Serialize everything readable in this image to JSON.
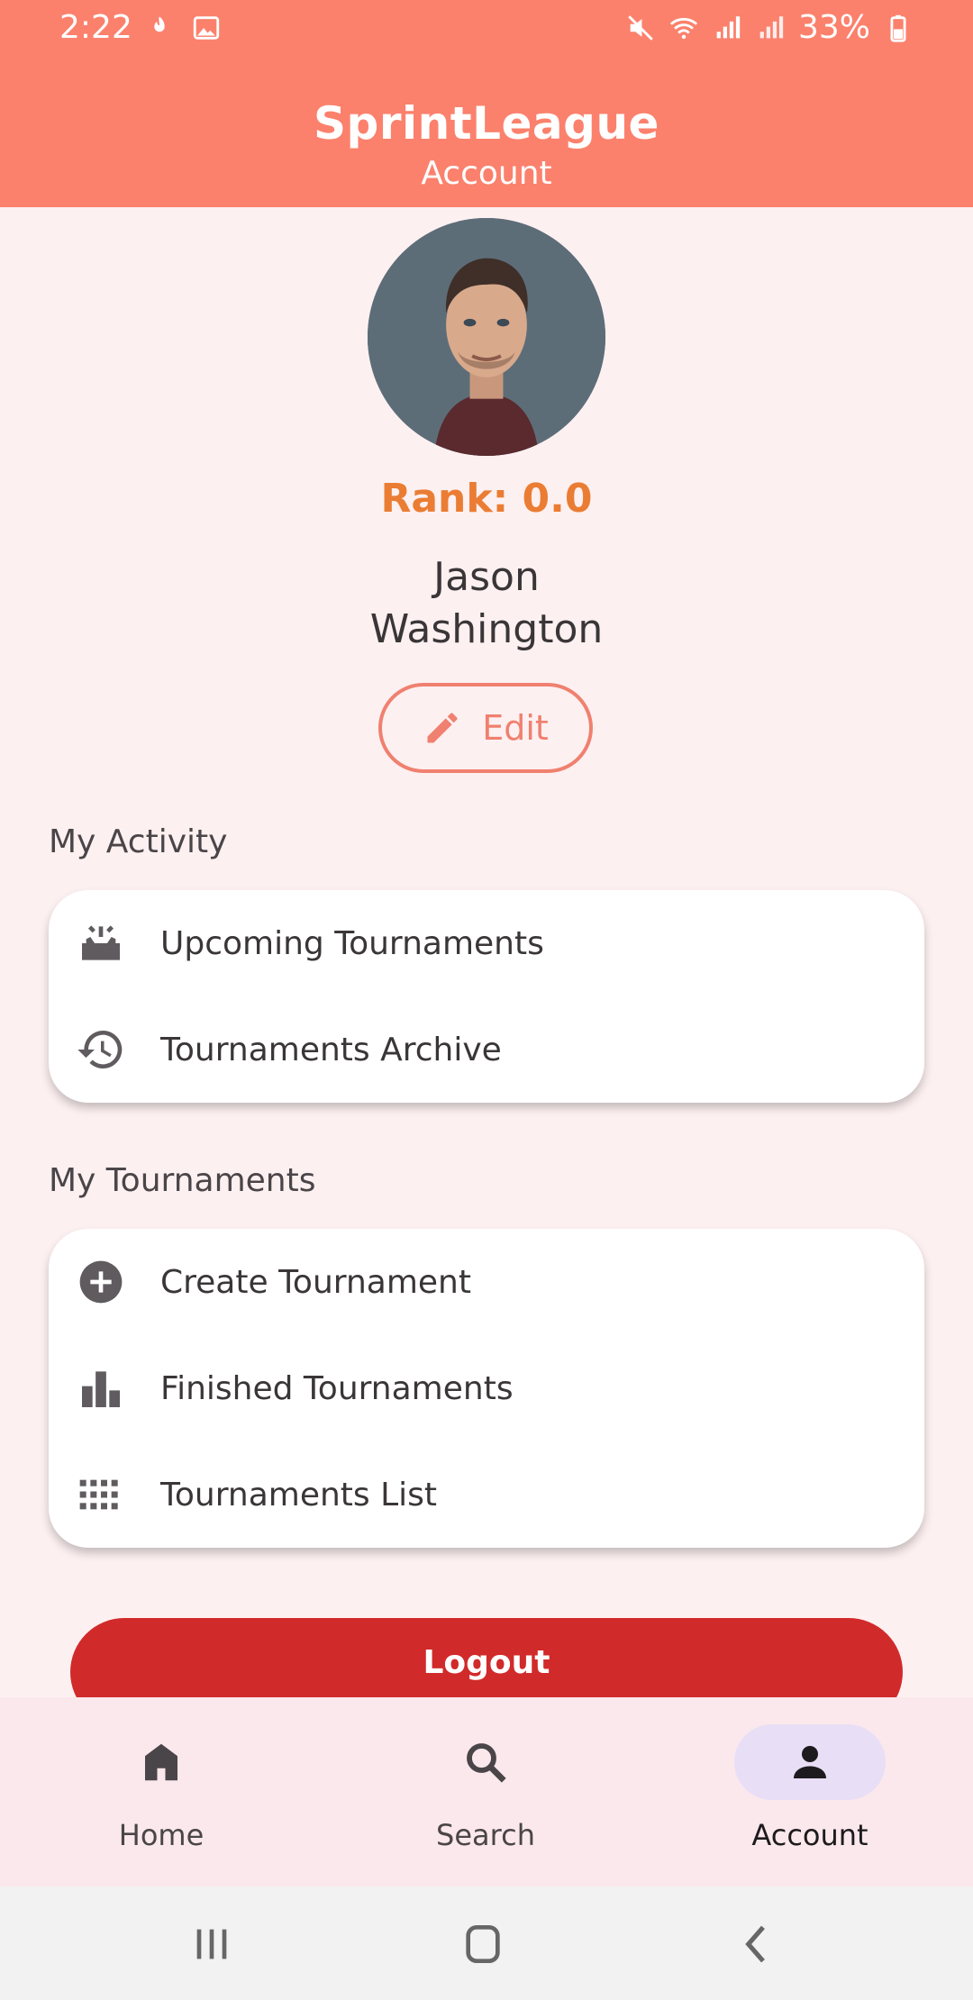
{
  "status_bar": {
    "time": "2:22",
    "battery": "33%"
  },
  "header": {
    "title": "SprintLeague",
    "subtitle": "Account"
  },
  "profile": {
    "rank": "Rank: 0.0",
    "first_name": "Jason",
    "last_name": "Washington",
    "edit_label": "Edit"
  },
  "activity": {
    "heading": "My Activity",
    "items": [
      {
        "label": "Upcoming Tournaments",
        "icon": "upcoming-icon"
      },
      {
        "label": "Tournaments Archive",
        "icon": "history-icon"
      }
    ]
  },
  "tournaments": {
    "heading": "My Tournaments",
    "items": [
      {
        "label": "Create Tournament",
        "icon": "add-circle-icon"
      },
      {
        "label": "Finished Tournaments",
        "icon": "bar-chart-icon"
      },
      {
        "label": "Tournaments List",
        "icon": "grid-icon"
      }
    ]
  },
  "logout_label": "Logout",
  "bottom_nav": {
    "items": [
      {
        "label": "Home",
        "icon": "home-icon"
      },
      {
        "label": "Search",
        "icon": "search-icon"
      },
      {
        "label": "Account",
        "icon": "person-icon",
        "active": true
      }
    ]
  },
  "colors": {
    "header": "#fb816d",
    "rank": "#ea7d33",
    "accent": "#f0806f",
    "logout": "#d12a2a",
    "nav_active": "#e8def6"
  }
}
